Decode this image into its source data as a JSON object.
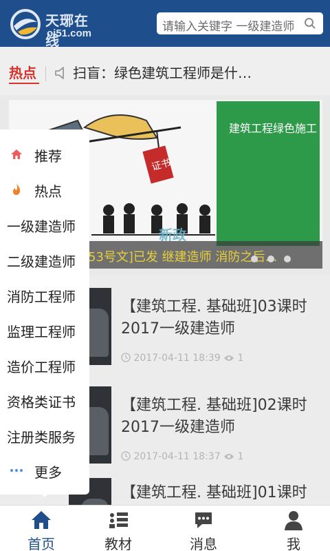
{
  "header": {
    "logo_cn": "天琊在线",
    "logo_en": "oi51.com",
    "search_placeholder": "请输入关键字 一级建造师",
    "brand_color": "#1e4f8c"
  },
  "hot": {
    "label": "热点",
    "headline": "扫盲：绿色建筑工程师是什…"
  },
  "banner": {
    "book_title": "建筑工程绿色施工",
    "stamp_text": "新政",
    "caption": "53号文]已发 继建造师 消防之后…",
    "dot_count": 3
  },
  "courses": [
    {
      "title": "【建筑工程. 基础班]03课时 2017一级建造师",
      "date": "2017-04-11 18:39",
      "views": "1"
    },
    {
      "title": "【建筑工程. 基础班]02课时 2017一级建造师",
      "date": "2017-04-11 18:37",
      "views": "1"
    },
    {
      "title": "【建筑工程. 基础班]01课时",
      "date": "",
      "views": ""
    }
  ],
  "menu": {
    "items": [
      {
        "label": "推荐",
        "icon": "home-icon"
      },
      {
        "label": "热点",
        "icon": "flame-icon"
      },
      {
        "label": "一级建造师"
      },
      {
        "label": "二级建造师"
      },
      {
        "label": "消防工程师"
      },
      {
        "label": "监理工程师"
      },
      {
        "label": "造价工程师"
      },
      {
        "label": "资格类证书"
      },
      {
        "label": "注册类服务"
      },
      {
        "label": "更多",
        "icon": "more-dots-icon"
      }
    ]
  },
  "tabs": [
    {
      "label": "首页",
      "icon": "home-icon",
      "active": true
    },
    {
      "label": "教材",
      "icon": "list-icon",
      "active": false
    },
    {
      "label": "消息",
      "icon": "chat-icon",
      "active": false
    },
    {
      "label": "我",
      "icon": "user-icon",
      "active": false
    }
  ]
}
